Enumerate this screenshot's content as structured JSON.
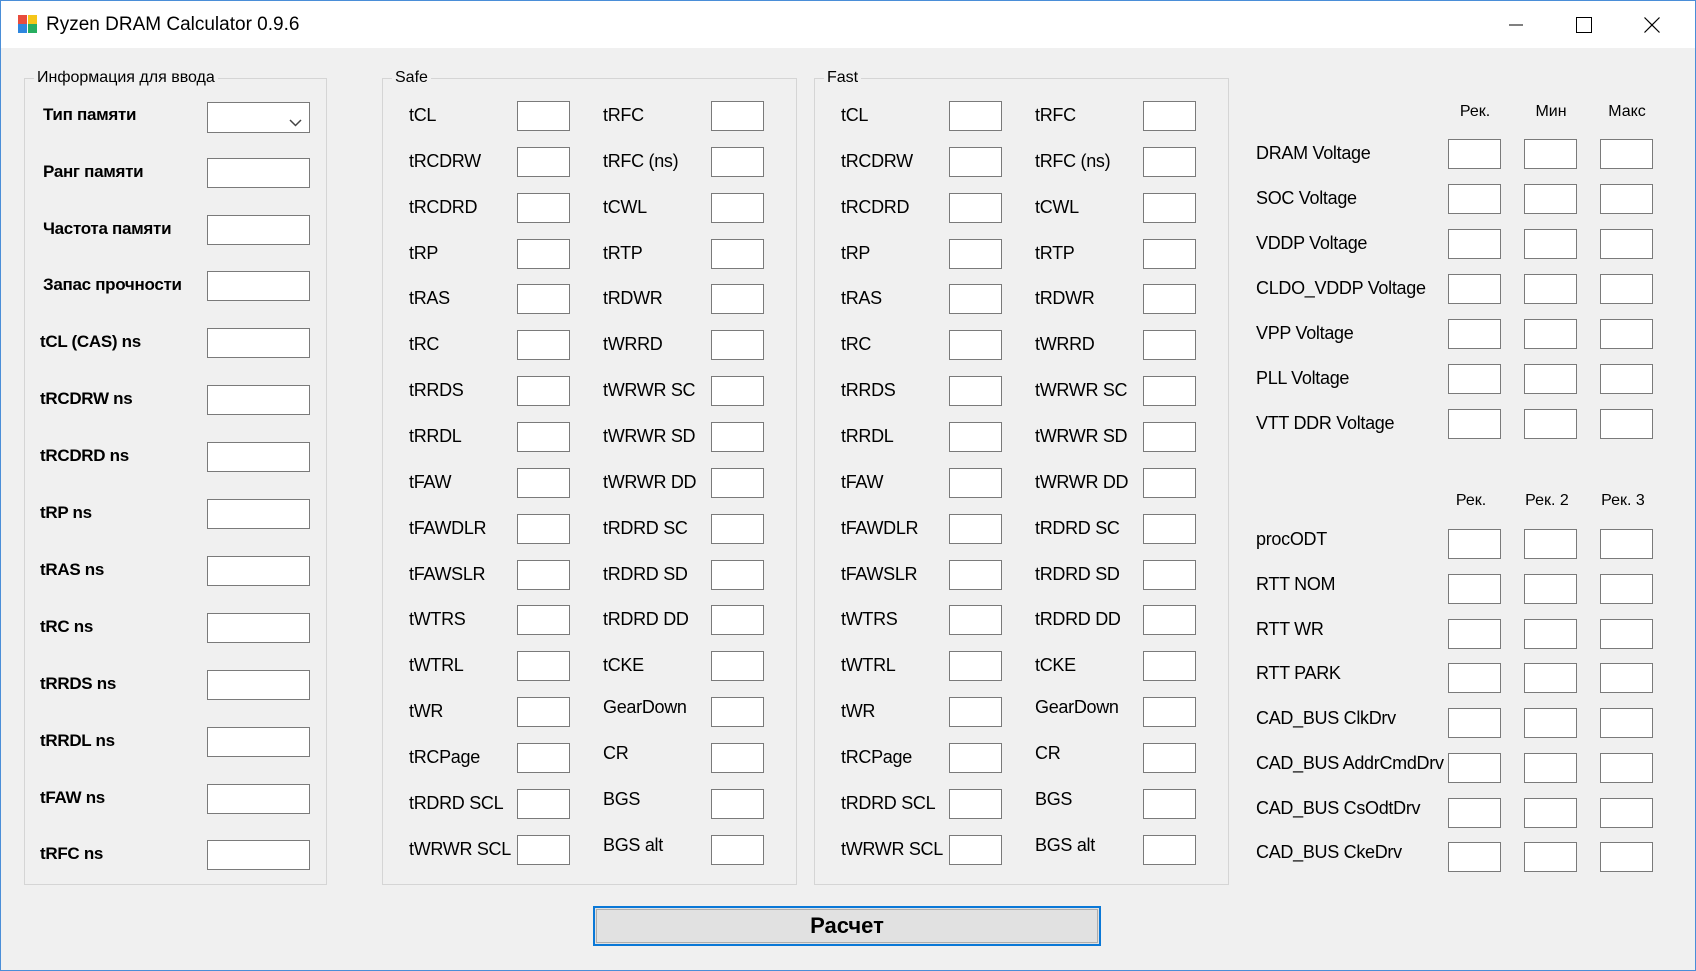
{
  "window": {
    "title": "Ryzen DRAM Calculator 0.9.6",
    "icons": {
      "app": "app-logo-icon",
      "minimize": "minimize-icon",
      "maximize": "maximize-icon",
      "close": "close-icon"
    }
  },
  "input_group": {
    "title": "Информация для ввода",
    "memory_type": {
      "label": "Тип памяти",
      "value": ""
    },
    "fields": [
      {
        "label": "Ранг памяти",
        "value": ""
      },
      {
        "label": "Частота памяти",
        "value": ""
      },
      {
        "label": "Запас прочности",
        "value": ""
      },
      {
        "label": "tCL (CAS) ns",
        "value": ""
      },
      {
        "label": "tRCDRW ns",
        "value": ""
      },
      {
        "label": "tRCDRD ns",
        "value": ""
      },
      {
        "label": "tRP ns",
        "value": ""
      },
      {
        "label": "tRAS ns",
        "value": ""
      },
      {
        "label": "tRC ns",
        "value": ""
      },
      {
        "label": "tRRDS ns",
        "value": ""
      },
      {
        "label": "tRRDL ns",
        "value": ""
      },
      {
        "label": "tFAW ns",
        "value": ""
      },
      {
        "label": "tRFC ns",
        "value": ""
      }
    ]
  },
  "safe_group": {
    "title": "Safe",
    "left": [
      "tCL",
      "tRCDRW",
      "tRCDRD",
      "tRP",
      "tRAS",
      "tRC",
      "tRRDS",
      "tRRDL",
      "tFAW",
      "tFAWDLR",
      "tFAWSLR",
      "tWTRS",
      "tWTRL",
      "tWR",
      "tRCPage",
      "tRDRD SCL",
      "tWRWR SCL"
    ],
    "right": [
      "tRFC",
      "tRFC (ns)",
      "tCWL",
      "tRTP",
      "tRDWR",
      "tWRRD",
      "tWRWR SC",
      "tWRWR SD",
      "tWRWR DD",
      "tRDRD SC",
      "tRDRD SD",
      "tRDRD DD",
      "tCKE",
      "GearDown",
      "CR",
      "BGS",
      "BGS alt"
    ]
  },
  "fast_group": {
    "title": "Fast",
    "left": [
      "tCL",
      "tRCDRW",
      "tRCDRD",
      "tRP",
      "tRAS",
      "tRC",
      "tRRDS",
      "tRRDL",
      "tFAW",
      "tFAWDLR",
      "tFAWSLR",
      "tWTRS",
      "tWTRL",
      "tWR",
      "tRCPage",
      "tRDRD SCL",
      "tWRWR SCL"
    ],
    "right": [
      "tRFC",
      "tRFC (ns)",
      "tCWL",
      "tRTP",
      "tRDWR",
      "tWRRD",
      "tWRWR SC",
      "tWRWR SD",
      "tWRWR DD",
      "tRDRD SC",
      "tRDRD SD",
      "tRDRD DD",
      "tCKE",
      "GearDown",
      "CR",
      "BGS",
      "BGS alt"
    ]
  },
  "voltages": {
    "headers": [
      "Рек.",
      "Мин",
      "Макс"
    ],
    "rows": [
      "DRAM Voltage",
      "SOC Voltage",
      "VDDP Voltage",
      "CLDO_VDDP Voltage",
      "VPP Voltage",
      "PLL Voltage",
      "VTT DDR Voltage"
    ]
  },
  "drive": {
    "headers": [
      "Рек.",
      "Рек. 2",
      "Рек. 3"
    ],
    "rows": [
      "procODT",
      "RTT NOM",
      "RTT WR",
      "RTT PARK",
      "CAD_BUS ClkDrv",
      "CAD_BUS AddrCmdDrv",
      "CAD_BUS CsOdtDrv",
      "CAD_BUS CkeDrv"
    ]
  },
  "calculate_button": {
    "label": "Расчет"
  }
}
